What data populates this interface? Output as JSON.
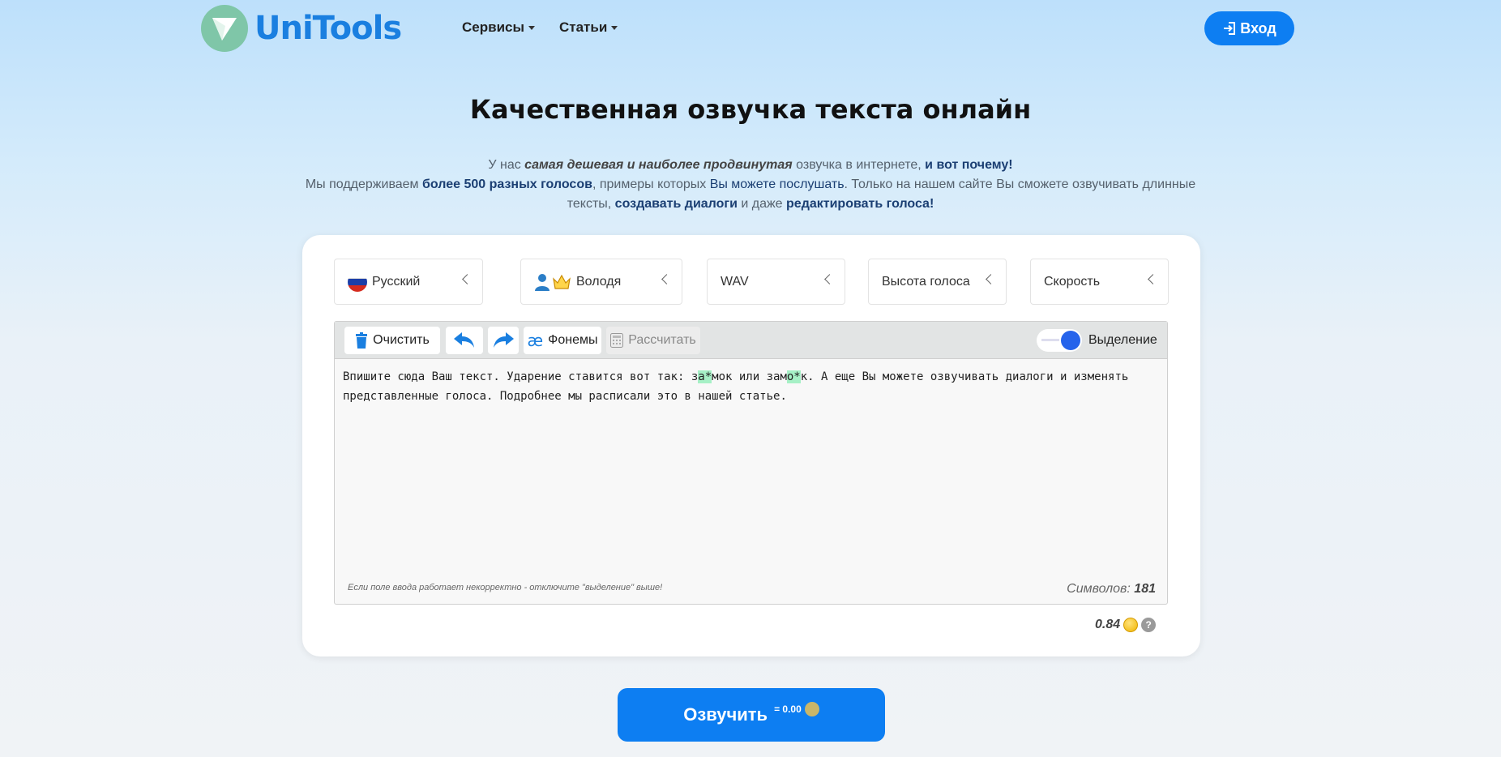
{
  "header": {
    "logo_text": "UniTools",
    "nav": [
      "Сервисы",
      "Статьи"
    ],
    "login_label": "Вход"
  },
  "hero": {
    "title": "Качественная озвучка текста онлайн",
    "line1": [
      "У нас ",
      "самая дешевая и наиболее продвинутая",
      " озвучка в интернете, ",
      "и вот почему!"
    ],
    "line2": [
      "Мы поддерживаем ",
      "более 500 разных голосов",
      ", примеры которых ",
      "Вы можете послушать",
      ". Только на нашем сайте Вы сможете озвучивать длинные"
    ],
    "line3": [
      "тексты, ",
      "создавать диалоги",
      " и даже ",
      "редактировать голоса!"
    ]
  },
  "selectors": {
    "language": "Русский",
    "voice": "Володя",
    "format": "WAV",
    "pitch": "Высота голоса",
    "speed": "Скорость"
  },
  "toolbar": {
    "clear": "Очистить",
    "phonemes": "Фонемы",
    "calculate": "Рассчитать",
    "highlight": "Выделение"
  },
  "editor": {
    "text_parts": [
      "Впишите сюда Ваш текст. Ударение ставится вот так: з",
      "а*",
      "мок или зам",
      "о*",
      "к. А еще Вы можете озвучивать диалоги и изменять представленные голоса. Подробнее мы расписали это в нашей статье."
    ],
    "hint": "Если поле ввода работает некорректно - отключите \"выделение\" выше!",
    "count_label": "Символов: ",
    "count_value": "181"
  },
  "price": {
    "value": "0.84",
    "help": "?"
  },
  "speak": {
    "label": "Озвучить",
    "cost": "= 0.00"
  },
  "colors": {
    "accent": "#0d7ef2",
    "logo_green": "#7fc6a8",
    "highlight": "#a6f0c6"
  }
}
